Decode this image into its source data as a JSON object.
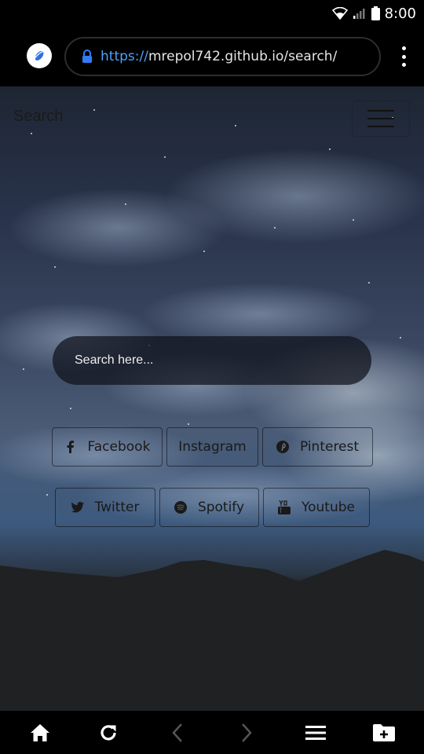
{
  "status_bar": {
    "time": "8:00"
  },
  "browser": {
    "url_scheme": "https://",
    "url_rest": "mrepol742.github.io/search/"
  },
  "page": {
    "title": "Search",
    "search": {
      "placeholder": "Search here..."
    },
    "social_buttons": [
      {
        "label": "Facebook",
        "icon": "facebook-icon"
      },
      {
        "label": "Instagram",
        "icon": "instagram-icon"
      },
      {
        "label": "Pinterest",
        "icon": "pinterest-icon"
      },
      {
        "label": "Twitter",
        "icon": "twitter-icon"
      },
      {
        "label": "Spotify",
        "icon": "spotify-icon"
      },
      {
        "label": "Youtube",
        "icon": "youtube-icon"
      }
    ]
  },
  "bottom_nav": [
    "home-icon",
    "reload-icon",
    "back-icon",
    "forward-icon",
    "menu-icon",
    "add-folder-icon"
  ]
}
